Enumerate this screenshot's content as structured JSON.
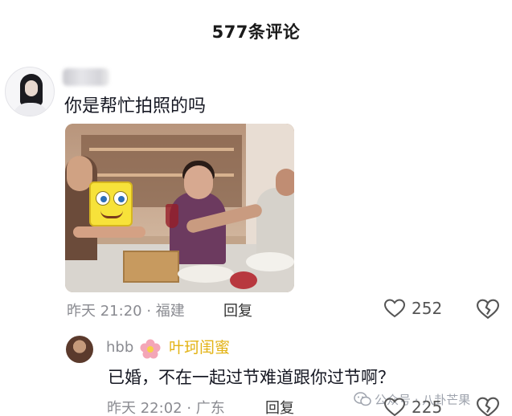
{
  "header": {
    "title": "577条评论"
  },
  "comment1": {
    "text": "你是帮忙拍照的吗",
    "meta": "昨天 21:20 · 福建",
    "reply_label": "回复",
    "likes": "252"
  },
  "comment2": {
    "username": "hbb",
    "tag": "叶珂闺蜜",
    "text": "已婚，不在一起过节难道跟你过节啊？",
    "meta": "昨天 22:02 · 广东",
    "reply_label": "回复",
    "likes": "225"
  },
  "watermark": {
    "text": "公众号 · 八卦芒果"
  },
  "colors": {
    "tag": "#e3b315",
    "meta": "#8a8b91",
    "text": "#161823"
  }
}
